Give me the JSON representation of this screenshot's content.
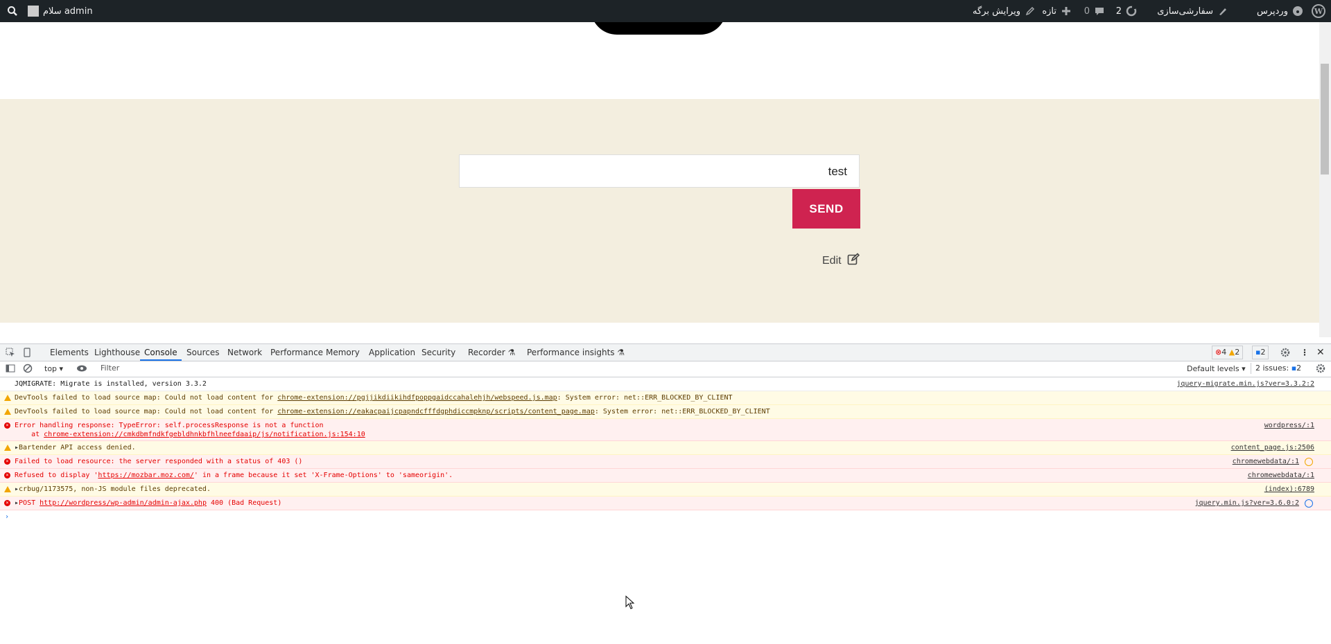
{
  "adminbar": {
    "wp_logo": "wordpress-logo-icon",
    "site_name": "وردپرس",
    "customize": "سفارشی‌سازی",
    "updates_count": "2",
    "comments_count": "0",
    "new_label": "تازه",
    "edit_page": "ویرایش برگه",
    "greeting": "سلام admin",
    "search_icon": "search-icon"
  },
  "form": {
    "input_value": "test",
    "send_label": "SEND",
    "edit_label": "Edit"
  },
  "devtools": {
    "tabs": [
      "Elements",
      "Lighthouse",
      "Console",
      "Sources",
      "Network",
      "Performance",
      "Memory",
      "Application",
      "Security",
      "Recorder",
      "Performance insights"
    ],
    "active_tab": "Console",
    "error_count": "4",
    "warning_count": "2",
    "message_count": "2",
    "context": "top",
    "filter_placeholder": "Filter",
    "levels": "Default levels",
    "issues_label": "2 issues:",
    "issues_count": "2",
    "prompt": "›",
    "messages": [
      {
        "level": "info",
        "text": "JQMIGRATE: Migrate is installed, version 3.3.2",
        "source": "jquery-migrate.min.js?ver=3.3.2:2"
      },
      {
        "level": "warn",
        "prefix": "DevTools failed to load source map: Could not load content for ",
        "link": "chrome-extension://pgjjikdiikihdfpoppgaidccahalehjh/webspeed.js.map",
        "suffix": ": System error: net::ERR_BLOCKED_BY_CLIENT",
        "source": ""
      },
      {
        "level": "warn",
        "prefix": "DevTools failed to load source map: Could not load content for ",
        "link": "chrome-extension://eakacpaijcpapndcfffdgphdiccmpknp/scripts/content_page.map",
        "suffix": ": System error: net::ERR_BLOCKED_BY_CLIENT",
        "source": ""
      },
      {
        "level": "error",
        "text": "Error handling response: TypeError: self.processResponse is not a function",
        "line2_prefix": "    at ",
        "line2_link": "chrome-extension://cmkdbmfndkfgebldhnkbfhlneefdaaip/js/notification.js:154:10",
        "source": "wordpress/:1"
      },
      {
        "level": "warn",
        "text": "Bartender API access denied.",
        "source": "content_page.js:2506"
      },
      {
        "level": "error",
        "text": "Failed to load resource: the server responded with a status of 403 ()",
        "source": "chromewebdata/:1"
      },
      {
        "level": "error",
        "prefix": "Refused to display '",
        "link": "https://mozbar.moz.com/",
        "suffix": "' in a frame because it set 'X-Frame-Options' to 'sameorigin'.",
        "source": "chromewebdata/:1"
      },
      {
        "level": "warn",
        "text": "crbug/1173575, non-JS module files deprecated.",
        "source": "(index):6789"
      },
      {
        "level": "error",
        "prefix": "POST ",
        "link": "http://wordpress/wp-admin/admin-ajax.php",
        "suffix": " 400 (Bad Request)",
        "source": "jquery.min.js?ver=3.6.0:2"
      }
    ]
  }
}
